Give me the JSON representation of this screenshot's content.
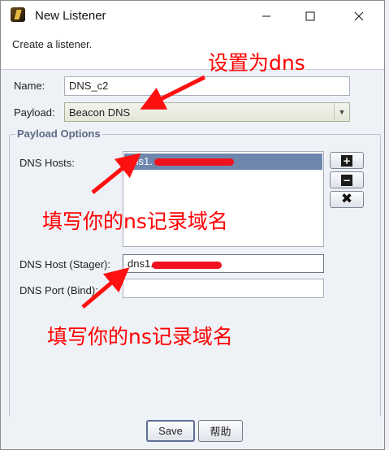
{
  "window": {
    "title": "New Listener"
  },
  "description": "Create a listener.",
  "form": {
    "name_label": "Name:",
    "name_value": "DNS_c2",
    "payload_label": "Payload:",
    "payload_value": "Beacon DNS",
    "group_title": "Payload Options",
    "dns_hosts_label": "DNS Hosts:",
    "dns_hosts": [
      "dns1."
    ],
    "dns_host_stager_label": "DNS Host (Stager):",
    "dns_host_stager_value": "dns1.",
    "dns_port_label": "DNS Port (Bind):",
    "dns_port_value": ""
  },
  "buttons": {
    "save": "Save",
    "help": "帮助"
  },
  "annotations": {
    "set_to_dns": "设置为dns",
    "fill_ns_1": "填写你的ns记录域名",
    "fill_ns_2": "填写你的ns记录域名"
  },
  "colors": {
    "annotation": "#ff0000",
    "selection": "#6e86ad",
    "redaction": "#f1121f"
  }
}
